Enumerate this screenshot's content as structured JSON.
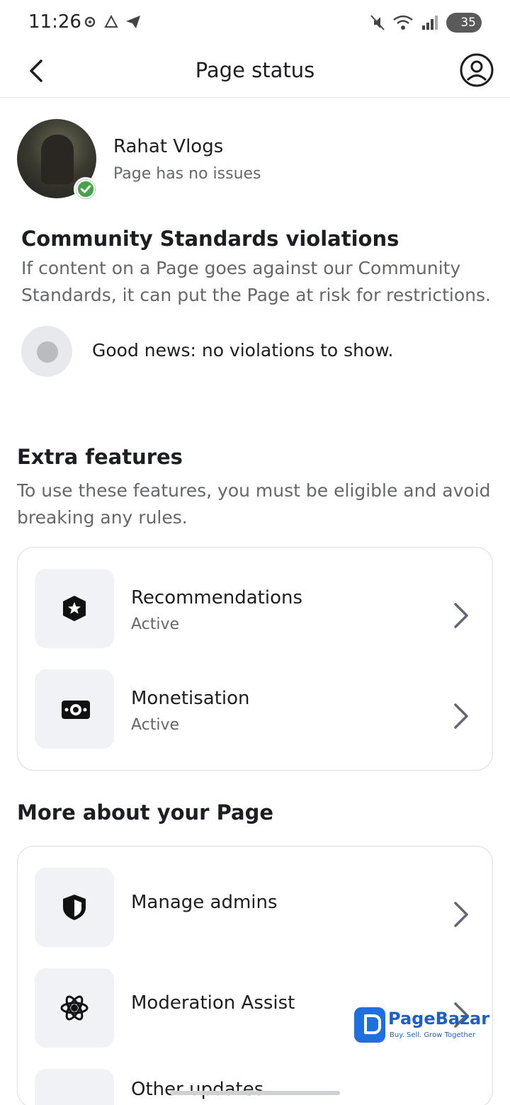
{
  "status_bar": {
    "time": "11:26",
    "battery": "35",
    "icons": [
      "gear-icon",
      "alert-icon",
      "send-icon",
      "mute-icon",
      "wifi-icon",
      "signal-icon"
    ]
  },
  "header": {
    "title": "Page status",
    "back_icon": "chevron-left-icon",
    "profile_icon": "user-circle-icon"
  },
  "page": {
    "name": "Rahat Vlogs",
    "status": "Page has no issues"
  },
  "community": {
    "title": "Community Standards violations",
    "description": "If content on a Page goes against our Community Standards, it can put the Page at risk for restrictions.",
    "good_news": "Good news: no violations to show."
  },
  "extra_features": {
    "title": "Extra features",
    "description": "To use these features, you must be eligible and avoid breaking any rules.",
    "items": [
      {
        "label": "Recommendations",
        "status": "Active",
        "icon": "badge-star-icon"
      },
      {
        "label": "Monetisation",
        "status": "Active",
        "icon": "money-icon"
      }
    ]
  },
  "more_about": {
    "title": "More about your Page",
    "items": [
      {
        "label": "Manage admins",
        "icon": "shield-icon"
      },
      {
        "label": "Moderation Assist",
        "icon": "atom-star-icon"
      },
      {
        "label": "Other updates",
        "icon": "update-icon"
      }
    ]
  },
  "watermark": {
    "brand": "PageBazar",
    "tagline": "Buy. Sell. Grow Together"
  },
  "colors": {
    "text": "#1c1e21",
    "secondary": "#65676b",
    "verified": "#46a34a",
    "brand": "#1f6fe0"
  }
}
